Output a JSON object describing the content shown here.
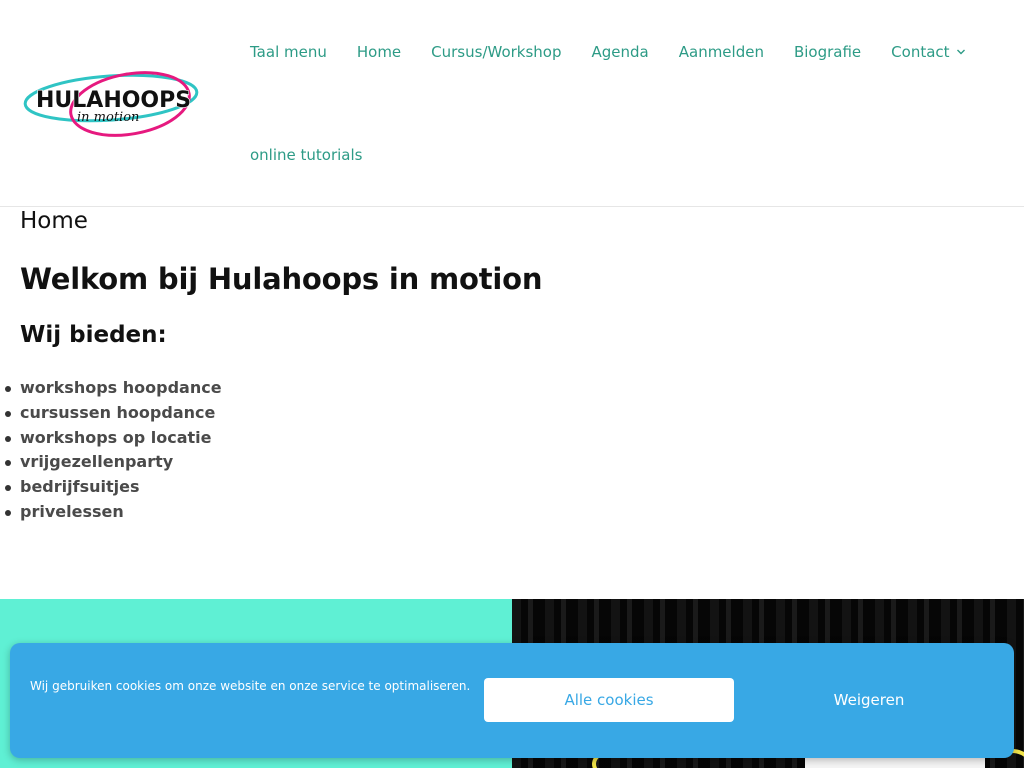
{
  "logo": {
    "alt": "Hulahoops in motion",
    "brand_text": "HULAHOOPS",
    "tagline": "in motion",
    "colors": {
      "teal_ring": "#2fc4c4",
      "pink_ring": "#e6197f",
      "text": "#111111"
    }
  },
  "nav": {
    "items": [
      {
        "label": "Taal menu"
      },
      {
        "label": "Home"
      },
      {
        "label": "Cursus/Workshop"
      },
      {
        "label": "Agenda"
      },
      {
        "label": "Aanmelden"
      },
      {
        "label": "Biografie"
      },
      {
        "label": "Contact",
        "icon": "chevron-down-icon"
      }
    ],
    "second_row": [
      {
        "label": "online tutorials"
      }
    ],
    "link_color": "#2d9b86"
  },
  "page": {
    "breadcrumb_title": "Home",
    "heading": "Welkom bij Hulahoops in motion",
    "subheading": "Wij bieden:",
    "offers": [
      "workshops hoopdance",
      "cursussen hoopdance",
      "workshops op locatie",
      "vrijgezellenparty",
      "bedrijfsuitjes",
      "privelessen"
    ]
  },
  "banner": {
    "left_color": "#5ff0d4",
    "right_color": "#0b0b0b",
    "hoop_color": "#f1e34a"
  },
  "cookie": {
    "message": "Wij gebruiken cookies om onze website en onze service te optimaliseren.",
    "accept_label": "Alle cookies",
    "deny_label": "Weigeren",
    "background_color": "#38a8e5"
  }
}
